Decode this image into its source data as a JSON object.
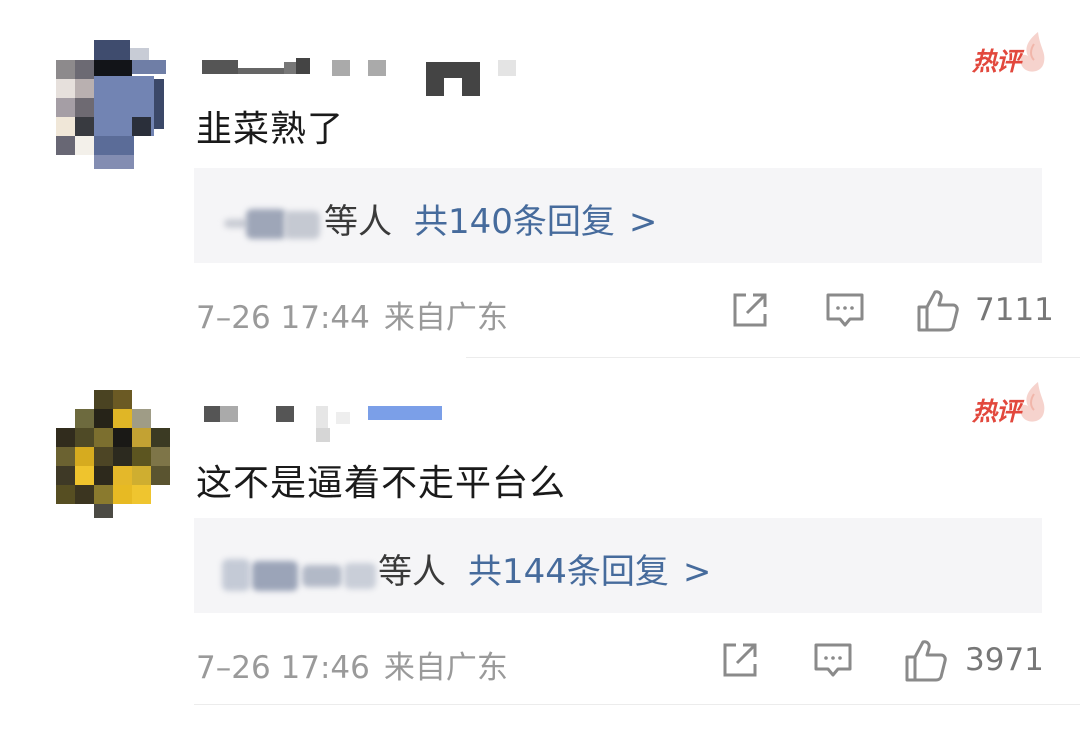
{
  "comments": [
    {
      "hot_badge": "热评",
      "text": "韭菜熟了",
      "reply_summary": {
        "others_suffix": "等人",
        "count_text": "共140条回复",
        "arrow": ">"
      },
      "date_time": "7–26 17:44",
      "region": "来自广东",
      "like_count": "7111",
      "icons": [
        "share-icon",
        "comment-icon",
        "thumbs-up-icon"
      ]
    },
    {
      "hot_badge": "热评",
      "text": "这不是逼着不走平台么",
      "reply_summary": {
        "others_suffix": "等人",
        "count_text": "共144条回复",
        "arrow": ">"
      },
      "date_time": "7–26 17:46",
      "region": "来自广东",
      "like_count": "3971",
      "icons": [
        "share-icon",
        "comment-icon",
        "thumbs-up-icon"
      ]
    }
  ],
  "colors": {
    "hot_badge": "#e2483d",
    "reply_link": "#466b9c",
    "reply_box_bg": "#f5f5f7",
    "meta_text": "#9a9a9a"
  }
}
